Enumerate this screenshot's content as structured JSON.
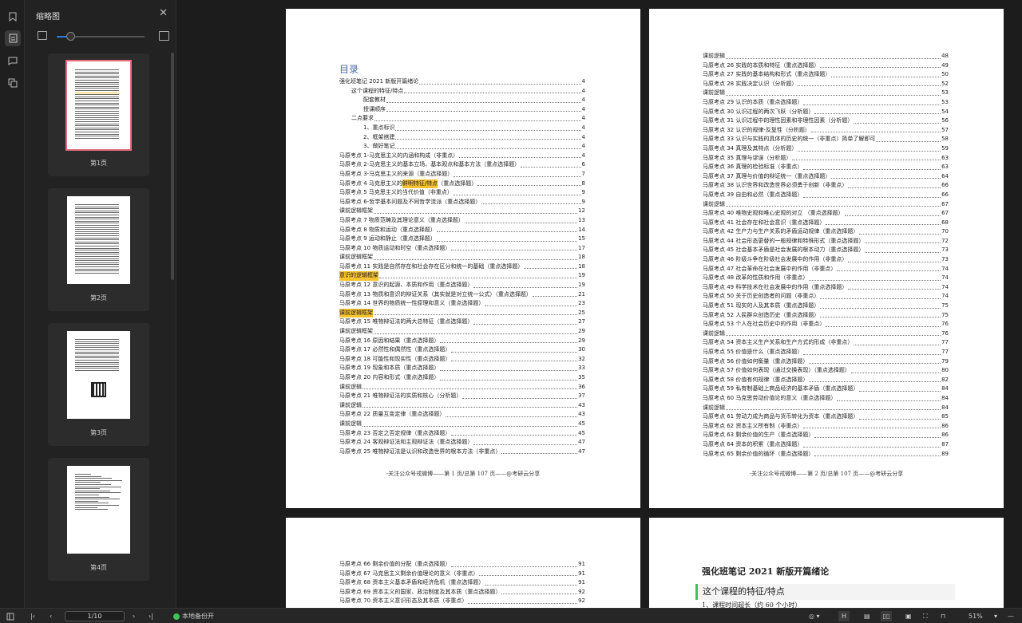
{
  "sidebar": {
    "title": "缩略图",
    "thumbnails": [
      {
        "label": "第1页"
      },
      {
        "label": "第2页"
      },
      {
        "label": "第3页"
      },
      {
        "label": "第4页"
      }
    ],
    "thumbnail_size_fraction": 0.15
  },
  "page1": {
    "toc_title": "目录",
    "entries": [
      {
        "t": "强化班笔记 2021 新版开篇绪论",
        "n": "4",
        "i": 0
      },
      {
        "t": "这个课程的特征/特点",
        "n": "4",
        "i": 1
      },
      {
        "t": "配套教材",
        "n": "4",
        "i": 2
      },
      {
        "t": "授课顺序",
        "n": "4",
        "i": 2
      },
      {
        "t": "二点要求",
        "n": "4",
        "i": 1
      },
      {
        "t": "1、重点标识",
        "n": "4",
        "i": 2
      },
      {
        "t": "2、框架搭建",
        "n": "4",
        "i": 2
      },
      {
        "t": "3、做好笔记",
        "n": "4",
        "i": 2
      },
      {
        "t": "马原考点 1-马克思主义的内涵和构成（非重点）",
        "n": "4",
        "i": 0
      },
      {
        "t": "马原考点 2-马克思主义的基本立场、基本观点和基本方法（重点选择题）",
        "n": "6",
        "i": 0
      },
      {
        "t": "马原考点 3-马克思主义的来源（重点选择题）",
        "n": "7",
        "i": 0
      },
      {
        "t": "马原考点 4 马克思主义的",
        "h": "鲜明特征/特点",
        "t2": "（重点选择题）",
        "n": "8",
        "i": 0
      },
      {
        "t": "马原考点 5 马克思主义的当代价值（非重点）",
        "n": "9",
        "i": 0
      },
      {
        "t": "马原考点 6-哲学基本问题及不同哲学流派（重点选择题）",
        "n": "9",
        "i": 0
      },
      {
        "t": "课前逻辑框架",
        "n": "12",
        "i": 0
      },
      {
        "t": "马原考点 7 物质范畴及其理论意义（重点选择题）",
        "n": "13",
        "i": 0
      },
      {
        "t": "马原考点 8  物质和运动（重点选择题）",
        "n": "14",
        "i": 0
      },
      {
        "t": "马原考点 9 运动和静止（重点选择题）",
        "n": "15",
        "i": 0
      },
      {
        "t": "马原考点 10 物质运动和时空（重点选择题）",
        "n": "17",
        "i": 0
      },
      {
        "t": "课前逻辑框架",
        "n": "18",
        "i": 0
      },
      {
        "t": "马原考点 11  实践是自然存在和社会存在区分和统一的基础（重点选择题）",
        "n": "18",
        "i": 0
      },
      {
        "t": "",
        "h": "意识的逻辑框架",
        "n": "19",
        "i": 0
      },
      {
        "t": "马原考点 12  意识的起源、本质和作用（重点选择题）",
        "n": "19",
        "i": 0
      },
      {
        "t": "马原考点 13  物质和意识的辩证关系（其实就是对立统一公式）（重点选择题）",
        "n": "21",
        "i": 0
      },
      {
        "t": "马原考点 14  世界的物质统一性原理和意义（重点选择题）",
        "n": "23",
        "i": 0
      },
      {
        "t": "",
        "h": "课前逻辑框架",
        "n": "25",
        "i": 0
      },
      {
        "t": "马原考点 15   唯物辩证法的两大总特征（重点选择题）",
        "n": "27",
        "i": 0
      },
      {
        "t": "课前逻辑框架",
        "n": "29",
        "i": 0
      },
      {
        "t": "马原考点 16  原因和结果（重点选择题）",
        "n": "29",
        "i": 0
      },
      {
        "t": "马原考点 17  必然性和偶然性（重点选择题）",
        "n": "30",
        "i": 0
      },
      {
        "t": "马原考点 18  可能性和现实性（重点选择题）",
        "n": "32",
        "i": 0
      },
      {
        "t": "马原考点 19  现象和本质（重点选择题）",
        "n": "33",
        "i": 0
      },
      {
        "t": "马原考点 20  内容和形式（重点选择题）",
        "n": "35",
        "i": 0
      },
      {
        "t": "课前逻辑",
        "n": "36",
        "i": 0
      },
      {
        "t": "马原考点 21  唯物辩证法的实质和核心（分析题）",
        "n": "37",
        "i": 0
      },
      {
        "t": "课前逻辑",
        "n": "43",
        "i": 0
      },
      {
        "t": "马原考点 22   质量互变定律（重点选择题）",
        "n": "43",
        "i": 0
      },
      {
        "t": "课前逻辑",
        "n": "45",
        "i": 0
      },
      {
        "t": "马原考点 23   否定之否定规律（重点选择题）",
        "n": "45",
        "i": 0
      },
      {
        "t": "马原考点 24   客观辩证法和主观辩证法（重点选择题）",
        "n": "47",
        "i": 0
      },
      {
        "t": "马原考点 25   唯物辩证法是认识和改造世界的根本方法（非重点）",
        "n": "47",
        "i": 0
      }
    ],
    "footer": "-关注公众号戎微博——第 1 页/总第 107 页——@考研云分享"
  },
  "page2": {
    "entries": [
      {
        "t": "课前逻辑",
        "n": "48",
        "i": 0
      },
      {
        "t": "马原考点 26  实践的本质和特征（重点选择题）",
        "n": "49",
        "i": 0
      },
      {
        "t": "马原考点 27  实践的基本结构和形式（重点选择题）",
        "n": "50",
        "i": 0
      },
      {
        "t": "马原考点 28  实践决定认识（分析题）",
        "n": "52",
        "i": 0
      },
      {
        "t": "课前逻辑",
        "n": "53",
        "i": 0
      },
      {
        "t": "马原考点 29  认识的本质（重点选择题）",
        "n": "53",
        "i": 0
      },
      {
        "t": "马原考点 30   认识过程的两次飞跃（分析题）",
        "n": "54",
        "i": 0
      },
      {
        "t": "马原考点  31   认识过程中的理性因素和非理性因素（分析题）",
        "n": "56",
        "i": 0
      },
      {
        "t": "马原考点  32   认识的规律-反复性（分析题）",
        "n": "57",
        "i": 0
      },
      {
        "t": "马原考点 33   认识与实践的具体的历史的统一（非重点）简单了解即可",
        "n": "58",
        "i": 0
      },
      {
        "t": "马原考点 34   真理及其特点（分析题）",
        "n": "59",
        "i": 0
      },
      {
        "t": "马原考点 35   真理与谬误（分析题）",
        "n": "63",
        "i": 0
      },
      {
        "t": "马原考点 36   真理的检验标准（非重点）",
        "n": "63",
        "i": 0
      },
      {
        "t": "马原考点 37   真理与价值的辩证统一（重点选择题）",
        "n": "64",
        "i": 0
      },
      {
        "t": "马原考点 38  认识世界和改造世界必须勇于创新（非重点）",
        "n": "66",
        "i": 0
      },
      {
        "t": "马原考点 39   自由和必然（重点选择题）",
        "n": "66",
        "i": 0
      },
      {
        "t": "课前逻辑",
        "n": "67",
        "i": 0
      },
      {
        "t": "马原考点 40  唯物史观和唯心史观的对立 （重点选择题）",
        "n": "67",
        "i": 0
      },
      {
        "t": "马原考点 41  社会存在和社会意识（重点选择题）",
        "n": "68",
        "i": 0
      },
      {
        "t": "马原考点 42  生产力与生产关系的矛盾运动规律（重点选择题）",
        "n": "70",
        "i": 0
      },
      {
        "t": "马原考点 44  社会形态更替的一般规律和特殊形式（重点选择题）",
        "n": "72",
        "i": 0
      },
      {
        "t": "马原考点 45  社会基本矛盾是社会发展的根本动力（重点选择题）",
        "n": "73",
        "i": 0
      },
      {
        "t": "马原考点 46 阶级斗争在阶级社会发展中的作用（非重点）",
        "n": "73",
        "i": 0
      },
      {
        "t": "马原考点 47  社会革命在社会发展中的作用（非重点）",
        "n": "74",
        "i": 0
      },
      {
        "t": "马原考点 48 改革的性质和作用（非重点）",
        "n": "74",
        "i": 0
      },
      {
        "t": "马原考点 49 科学技术在社会发展中的作用（重点选择题）",
        "n": "74",
        "i": 0
      },
      {
        "t": "马原考点 50  关于历史创造者的问题（非重点）",
        "n": "74",
        "i": 0
      },
      {
        "t": "马原考点 51  现实的人及其本质（重点选择题）",
        "n": "75",
        "i": 0
      },
      {
        "t": "马原考点 52  人民群众创造历史（重点选择题）",
        "n": "75",
        "i": 0
      },
      {
        "t": "马原考点 53  个人在社会历史中的作用（非重点）",
        "n": "76",
        "i": 0
      },
      {
        "t": "课前逻辑",
        "n": "76",
        "i": 0
      },
      {
        "t": "马原考点 54  资本主义生产关系和生产方式的形成（非重点）",
        "n": "77",
        "i": 0
      },
      {
        "t": "马原考点 55 价值是什么（重点选择题）",
        "n": "77",
        "i": 0
      },
      {
        "t": "马原考点 56 价值如何衡量（重点选择题）",
        "n": "79",
        "i": 0
      },
      {
        "t": "马原考点 57  价值如何表现（通过交换表现）（重点选择题）",
        "n": "80",
        "i": 0
      },
      {
        "t": "马原考点 58 价值有何规律（重点选择题）",
        "n": "82",
        "i": 0
      },
      {
        "t": "马原考点 59 私有制基础上商品经济的基本矛盾（重点选择题）",
        "n": "84",
        "i": 0
      },
      {
        "t": "马原考点 60  马克思劳动价值论的意义（重点选择题）",
        "n": "84",
        "i": 0
      },
      {
        "t": "课前逻辑",
        "n": "84",
        "i": 0
      },
      {
        "t": "马原考点 61  劳动力成为商品与货币转化为资本（重点选择题）",
        "n": "85",
        "i": 0
      },
      {
        "t": "马原考点 62 资本主义所有制（非重点）",
        "n": "86",
        "i": 0
      },
      {
        "t": "马原考点 63 剩余价值的生产（重点选择题）",
        "n": "86",
        "i": 0
      },
      {
        "t": "马原考点 64 资本的积累（重点选择题）",
        "n": "87",
        "i": 0
      },
      {
        "t": "马原考点 65  剩余价值的循环（重点选择题）",
        "n": "89",
        "i": 0
      }
    ],
    "footer": "-关注公众号戎微博——第 2 页/总第 107 页——@考研云分享"
  },
  "page3": {
    "entries": [
      {
        "t": "马原考点 66 剩余价值的分配（重点选择题）",
        "n": "91",
        "i": 0
      },
      {
        "t": "马原考点 67  马克思主义剩余价值理论的意义（非重点）",
        "n": "91",
        "i": 0
      },
      {
        "t": "马原考点 68  资本主义基本矛盾和经济危机（重点选择题）",
        "n": "91",
        "i": 0
      },
      {
        "t": "马原考点 69  资本主义的国家、政治制度及其本质（重点选择题）",
        "n": "92",
        "i": 0
      },
      {
        "t": "马原考点 70   资本主义意识形态及其本质（非重点）",
        "n": "92",
        "i": 0
      }
    ]
  },
  "page4": {
    "title": "强化班笔记 2021 新版开篇绪论",
    "heading": "这个课程的特征/特点",
    "line1": "1、课程时间超长（约 60 个小时）"
  },
  "toolbar": {
    "page_value": "1/10",
    "status": "本地备份开",
    "zoom": "51%"
  },
  "colors": {
    "highlight": "#f7c32e",
    "accent": "#2f7bd8",
    "status_green": "#3cc45a",
    "selected_thumb": "#e46a7a"
  }
}
